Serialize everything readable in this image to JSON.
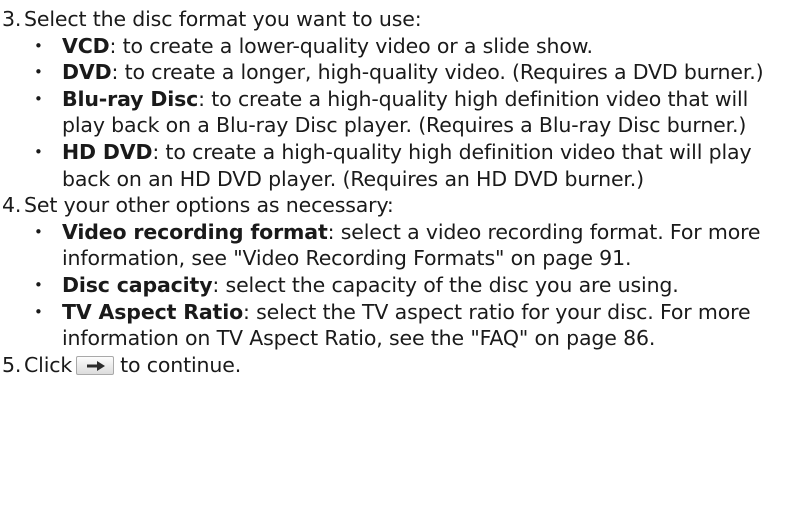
{
  "steps": [
    {
      "number": "3.",
      "text": "Select the disc format you want to use:",
      "bullets": [
        {
          "term": "VCD",
          "text": ": to create a lower-quality video or a slide show."
        },
        {
          "term": "DVD",
          "text": ": to create a longer, high-quality video. (Requires a DVD burner.)"
        },
        {
          "term": "Blu-ray Disc",
          "text": ": to create a high-quality high definition video that will play back on a Blu-ray Disc player. (Requires a Blu-ray Disc burner.)"
        },
        {
          "term": "HD DVD",
          "text": ": to create a high-quality high definition video that will play back on an HD DVD player. (Requires an HD DVD burner.)"
        }
      ]
    },
    {
      "number": "4.",
      "text": "Set your other options as necessary:",
      "bullets": [
        {
          "term": "Video recording format",
          "text": ": select a video recording format. For more information, see \"Video Recording Formats\" on page 91."
        },
        {
          "term": "Disc capacity",
          "text": ": select the capacity of the disc you are using."
        },
        {
          "term": "TV Aspect Ratio",
          "text": ": select the TV aspect ratio for your disc. For more information on TV Aspect Ratio, see the \"FAQ\" on page 86."
        }
      ]
    },
    {
      "number": "5.",
      "text_before": "Click",
      "text_after": "to continue.",
      "icon": "arrow-right-icon"
    }
  ],
  "bullet_glyph": "•"
}
